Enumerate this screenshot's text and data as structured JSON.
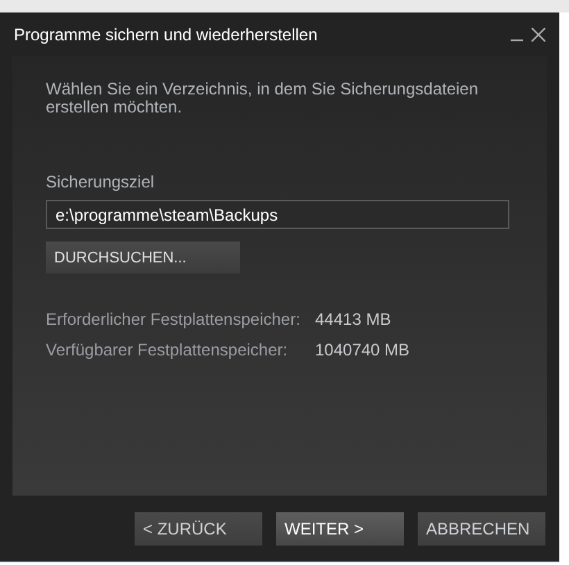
{
  "window": {
    "title": "Programme sichern und wiederherstellen"
  },
  "instruction": "Wählen Sie ein Verzeichnis, in dem Sie Sicherungsdateien erstellen möchten.",
  "destination": {
    "label": "Sicherungsziel",
    "value": "e:\\programme\\steam\\Backups"
  },
  "browse_button": "DURCHSUCHEN...",
  "space": [
    {
      "label": "Erforderlicher Festplattenspeicher:",
      "value": "44413 MB"
    },
    {
      "label": "Verfügbarer Festplattenspeicher:",
      "value": "1040740 MB"
    }
  ],
  "buttons": [
    {
      "label": "< ZURÜCK",
      "kind": "back"
    },
    {
      "label": "WEITER >",
      "kind": "next"
    },
    {
      "label": "ABBRECHEN",
      "kind": "cancel"
    }
  ]
}
